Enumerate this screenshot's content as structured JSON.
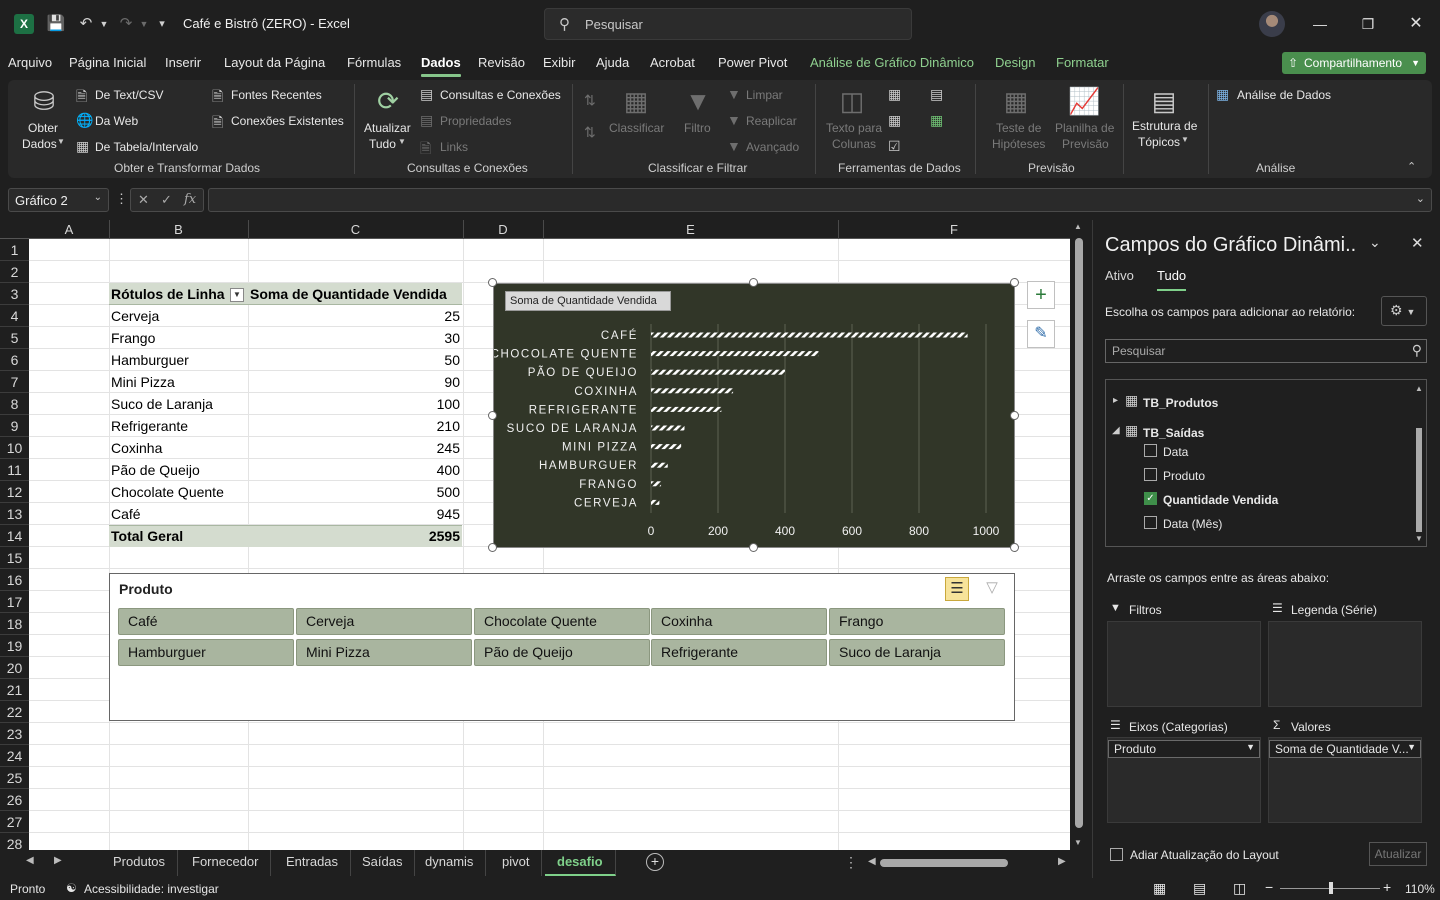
{
  "titlebar": {
    "title": "Café e Bistrô (ZERO)  -  Excel",
    "search_placeholder": "Pesquisar",
    "icons": [
      "excel-icon",
      "save-icon",
      "undo-icon",
      "redo-icon",
      "customize-icon",
      "search-icon",
      "minimize-icon",
      "restore-icon",
      "close-icon"
    ]
  },
  "menu": {
    "items": [
      "Arquivo",
      "Página Inicial",
      "Inserir",
      "Layout da Página",
      "Fórmulas",
      "Dados",
      "Revisão",
      "Exibir",
      "Ajuda",
      "Acrobat",
      "Power Pivot",
      "Análise de Gráfico Dinâmico",
      "Design",
      "Formatar"
    ],
    "active": "Dados",
    "share": "Compartilhamento"
  },
  "ribbon": {
    "obter": {
      "label1": "Obter",
      "label2": "Dados"
    },
    "text_csv": "De Text/CSV",
    "da_web": "Da Web",
    "de_tabela": "De Tabela/Intervalo",
    "fontes": "Fontes Recentes",
    "conexoes_exist": "Conexões Existentes",
    "group1": "Obter e Transformar Dados",
    "atualizar1": "Atualizar",
    "atualizar2": "Tudo",
    "consultas": "Consultas e Conexões",
    "propriedades": "Propriedades",
    "links": "Links",
    "group2": "Consultas e Conexões",
    "classificar": "Classificar",
    "filtro": "Filtro",
    "limpar": "Limpar",
    "reaplicar": "Reaplicar",
    "avancado": "Avançado",
    "group3": "Classificar e Filtrar",
    "texto1": "Texto para",
    "texto2": "Colunas",
    "group4": "Ferramentas de Dados",
    "teste1": "Teste de",
    "teste2": "Hipóteses",
    "planilha1": "Planilha de",
    "planilha2": "Previsão",
    "group5": "Previsão",
    "estrutura1": "Estrutura de",
    "estrutura2": "Tópicos",
    "analise_dados": "Análise de Dados",
    "group6": "Análise"
  },
  "formula_bar": {
    "name_box": "Gráfico 2",
    "fx": "fx",
    "value": ""
  },
  "columns": [
    "A",
    "B",
    "C",
    "D",
    "E",
    "F"
  ],
  "rows": [
    "1",
    "2",
    "3",
    "4",
    "5",
    "6",
    "7",
    "8",
    "9",
    "10",
    "11",
    "12",
    "13",
    "14",
    "15",
    "16",
    "17",
    "18",
    "19",
    "20",
    "21",
    "22",
    "23",
    "24",
    "25",
    "26",
    "27",
    "28"
  ],
  "pivot": {
    "header_label": "Rótulos de Linha",
    "header_value": "Soma de Quantidade Vendida",
    "rows": [
      {
        "label": "Cerveja",
        "value": "25"
      },
      {
        "label": "Frango",
        "value": "30"
      },
      {
        "label": "Hamburguer",
        "value": "50"
      },
      {
        "label": "Mini Pizza",
        "value": "90"
      },
      {
        "label": "Suco de Laranja",
        "value": "100"
      },
      {
        "label": "Refrigerante",
        "value": "210"
      },
      {
        "label": "Coxinha",
        "value": "245"
      },
      {
        "label": "Pão de Queijo",
        "value": "400"
      },
      {
        "label": "Chocolate Quente",
        "value": "500"
      },
      {
        "label": "Café",
        "value": "945"
      }
    ],
    "total_label": "Total Geral",
    "total_value": "2595"
  },
  "chart_data": {
    "type": "bar",
    "orientation": "horizontal",
    "title": "",
    "field_button": "Soma de Quantidade Vendida",
    "categories": [
      "CAFÉ",
      "CHOCOLATE QUENTE",
      "PÃO DE QUEIJO",
      "COXINHA",
      "REFRIGERANTE",
      "SUCO DE LARANJA",
      "MINI PIZZA",
      "HAMBURGUER",
      "FRANGO",
      "CERVEJA"
    ],
    "values": [
      945,
      500,
      400,
      245,
      210,
      100,
      90,
      50,
      30,
      25
    ],
    "xlim": [
      0,
      1000
    ],
    "ticks": [
      "0",
      "200",
      "400",
      "600",
      "800",
      "1000"
    ],
    "grid": true,
    "bar_pattern": "diagonal-stripes",
    "background": "#313628",
    "bar_color": "#ffffff"
  },
  "slicer": {
    "title": "Produto",
    "items": [
      "Café",
      "Cerveja",
      "Chocolate Quente",
      "Coxinha",
      "Frango",
      "Hamburguer",
      "Mini Pizza",
      "Pão de Queijo",
      "Refrigerante",
      "Suco de Laranja"
    ]
  },
  "sheets": {
    "tabs": [
      "Produtos",
      "Fornecedor",
      "Entradas",
      "Saídas",
      "dynamis",
      "pivot",
      "desafio"
    ],
    "active": "desafio"
  },
  "status": {
    "ready": "Pronto",
    "accessibility": "Acessibilidade: investigar",
    "zoom": "110%"
  },
  "pane": {
    "title": "Campos do Gráfico Dinâmi..",
    "tab_ativo": "Ativo",
    "tab_tudo": "Tudo",
    "choose": "Escolha os campos para adicionar ao relatório:",
    "search_placeholder": "Pesquisar",
    "table1": "TB_Produtos",
    "table2": "TB_Saídas",
    "fields": [
      {
        "name": "Data",
        "checked": false
      },
      {
        "name": "Produto",
        "checked": false
      },
      {
        "name": "Quantidade Vendida",
        "checked": true
      },
      {
        "name": "Data (Mês)",
        "checked": false
      }
    ],
    "drag": "Arraste os campos entre as áreas abaixo:",
    "filtros": "Filtros",
    "legenda": "Legenda (Série)",
    "eixos": "Eixos (Categorias)",
    "valores": "Valores",
    "eixos_value": "Produto",
    "valores_value": "Soma de Quantidade V...",
    "adiar": "Adiar Atualização do Layout",
    "atualizar": "Atualizar"
  },
  "colors": {
    "accent": "#86c58a",
    "share": "#4a8f4e",
    "pivot_header": "#d4dccf",
    "slicer_item": "#a9b59f",
    "chart_bg": "#313628"
  }
}
